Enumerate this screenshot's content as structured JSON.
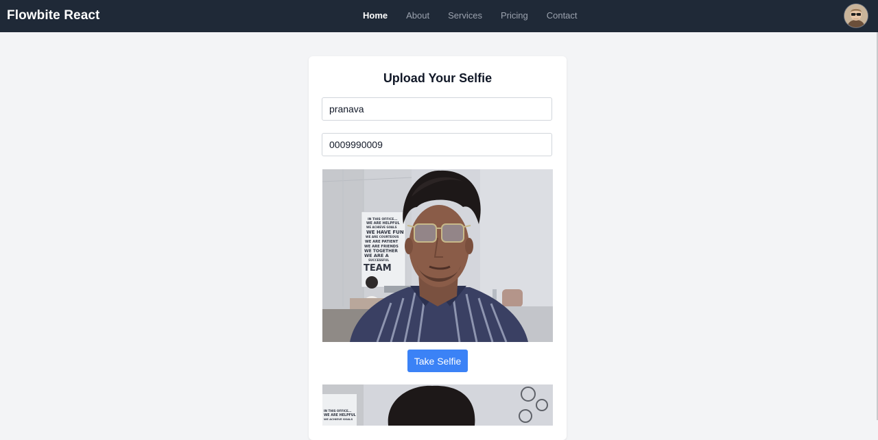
{
  "navbar": {
    "brand": "Flowbite React",
    "links": [
      {
        "label": "Home",
        "active": true
      },
      {
        "label": "About",
        "active": false
      },
      {
        "label": "Services",
        "active": false
      },
      {
        "label": "Pricing",
        "active": false
      },
      {
        "label": "Contact",
        "active": false
      }
    ],
    "avatar_icon": "user-avatar-icon"
  },
  "form": {
    "title": "Upload Your Selfie",
    "name_value": "pranava",
    "phone_value": "0009990009",
    "take_selfie_label": "Take Selfie"
  },
  "poster": {
    "lines": [
      "IN THIS OFFICE...",
      "WE ARE HELPFUL",
      "WE ACHIEVE GOALS",
      "WE HAVE FUN",
      "WE ARE COURTEOUS",
      "WE ARE PATIENT",
      "WE ARE FRIENDS",
      "WE TOGETHER",
      "WE ARE A",
      "SUCCESSFUL",
      "TEAM"
    ]
  },
  "colors": {
    "navbar_bg": "#1f2937",
    "page_bg": "#f3f4f6",
    "primary_button": "#3b82f6"
  }
}
